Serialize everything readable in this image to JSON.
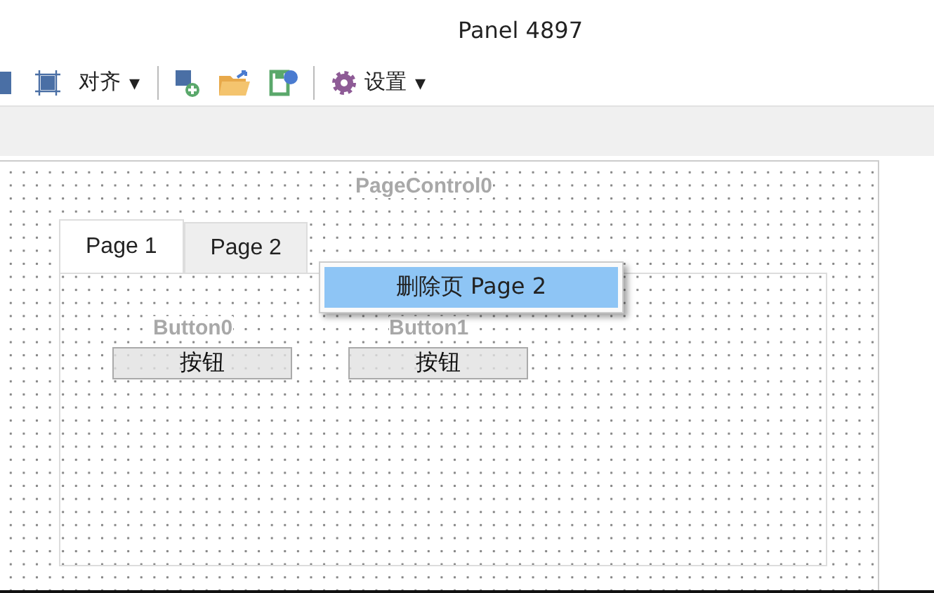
{
  "window": {
    "title": "Panel 4897"
  },
  "toolbar": [
    {
      "kind": "partial-icon"
    },
    {
      "kind": "menu",
      "label": "对齐",
      "caret": "▾"
    },
    {
      "kind": "separator"
    },
    {
      "kind": "new"
    },
    {
      "kind": "open"
    },
    {
      "kind": "save"
    },
    {
      "kind": "separator"
    },
    {
      "kind": "settings",
      "label": "设置",
      "caret": "▾"
    }
  ],
  "designer": {
    "page_control": {
      "label": "PageControl0",
      "tabs": [
        {
          "label": "Page 1",
          "selected": true
        },
        {
          "label": "Page 2",
          "selected": false
        }
      ],
      "controls": [
        {
          "label": "Button0",
          "caption": "按钮"
        },
        {
          "label": "Button1",
          "caption": "按钮"
        }
      ]
    },
    "context_menu": {
      "items": [
        {
          "label": "删除页 Page 2",
          "selected": true
        }
      ]
    }
  }
}
